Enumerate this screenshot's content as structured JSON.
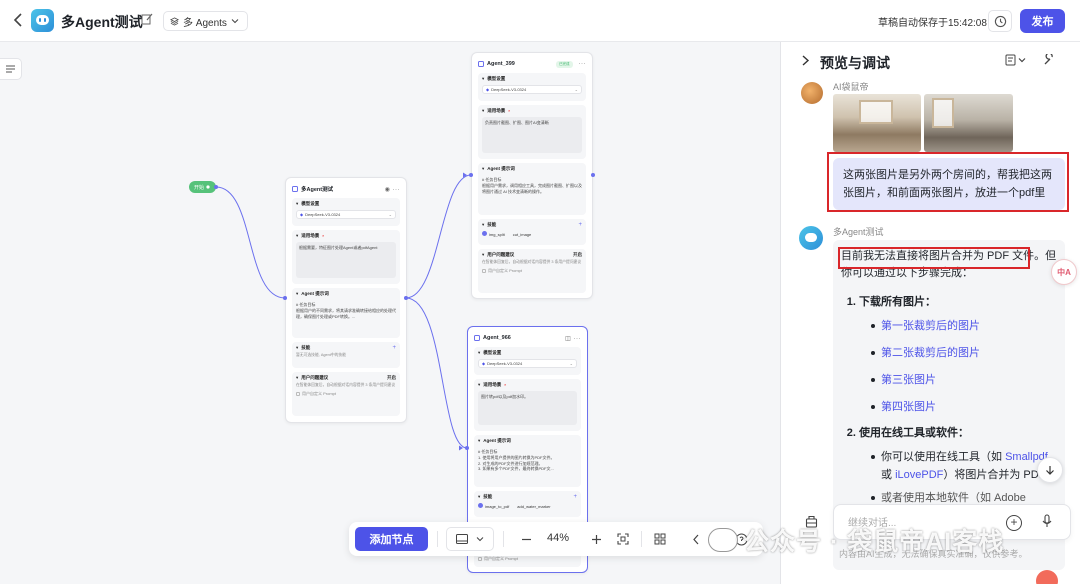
{
  "header": {
    "title": "多Agent测试",
    "agents_select": "多 Agents",
    "autosave": "草稿自动保存于15:42:08",
    "publish": "发布"
  },
  "canvas": {
    "start_node": "开始",
    "main_node": {
      "title": "多Agent测试",
      "model_section": "模型设置",
      "model": "DeepSeek-V3-0324",
      "scenario_section": "适用场景",
      "scenario_text": "根据需要，特征图片处理Agent或者pdfAgent",
      "prompt_section": "Agent 提示词",
      "prompt_text": "# 任务目标\n根据用户的不同需求，将其请求准确转接给相应的处理代理，确保图片处理或PDF转换。...",
      "skills_section": "技能",
      "skills_hint": "暂无可选技能, Agent中的技能",
      "suggest_section": "用户问题建议",
      "suggest_state": "开启",
      "suggest_text": "在智能体回复后，自动根据对话内容提供 3 条用户提问建议",
      "custom_prompt": "用户自定义 Prompt"
    },
    "agent_399": {
      "title": "Agent_399",
      "badge": "已完成",
      "model_section": "模型设置",
      "model": "DeepSeek-V3-0324",
      "scenario_section": "适用场景",
      "scenario_text": "负责图片截图、扩图、图片AI变清晰",
      "prompt_section": "Agent 提示词",
      "prompt_text": "# 任务目标\n根据用户需求，调用相应工具，完成图片截图、扩图以及将图片通过 AI 技术变清晰的操作。",
      "skills_section": "技能",
      "skill_1": "img_split",
      "skill_2": "cut_image",
      "suggest_section": "用户问题建议",
      "suggest_state": "开启",
      "suggest_text": "在智能体回复后，自动根据对话内容提供 3 条用户提问建议",
      "custom_prompt": "用户自定义 Prompt"
    },
    "agent_966": {
      "title": "Agent_966",
      "model_section": "模型设置",
      "model": "DeepSeek-V3-0324",
      "scenario_section": "适用场景",
      "scenario_text": "图片转pdf以及pdf加水印。",
      "prompt_section": "Agent 提示词",
      "prompt_text": "# 任务目标\n1. 使用将用户提供的图片转换为PDF文件。\n2. 对生成的PDF文件进行加规范理。\n3. 如果有多个PDF文件，最终转换PDF文...",
      "skills_section": "技能",
      "skill_1": "image_to_pdf",
      "skill_2": "add_water_marker",
      "custom_prompt": "用户自定义 Prompt"
    }
  },
  "toolbar": {
    "add_node": "添加节点",
    "zoom": "44%"
  },
  "watermark": "公众号 · 袋鼠帝AI客栈",
  "panel": {
    "title": "预览与调试",
    "user_name": "AI袋鼠帝",
    "user_message": "这两张图片是另外两个房间的，帮我把这两张图片，和前面两张图片，放进一个pdf里",
    "bot_name": "多Agent测试",
    "bot_intro": "目前我无法直接将图片合并为 PDF 文件。但你可以通过以下步骤完成：",
    "step1": "下载所有图片：",
    "links": [
      "第一张裁剪后的图片",
      "第二张裁剪后的图片",
      "第三张图片",
      "第四张图片"
    ],
    "step2": "使用在线工具或软件：",
    "tool_line_a": "你可以使用在线工具（如 ",
    "tool_link_1": "Smallpdf",
    "tool_line_b": " 或 ",
    "tool_link_2": "iLovePDF",
    "tool_line_c": "）将图片合并为 PDF。",
    "software_line": "或者使用本地软件（如 Adobe Acrobat、Microsoft Word）将图片插",
    "input_placeholder": "继续对话...",
    "disclaimer": "内容由AI生成，无法确保真实准确，仅供参考。",
    "translate_badge": "中A"
  }
}
